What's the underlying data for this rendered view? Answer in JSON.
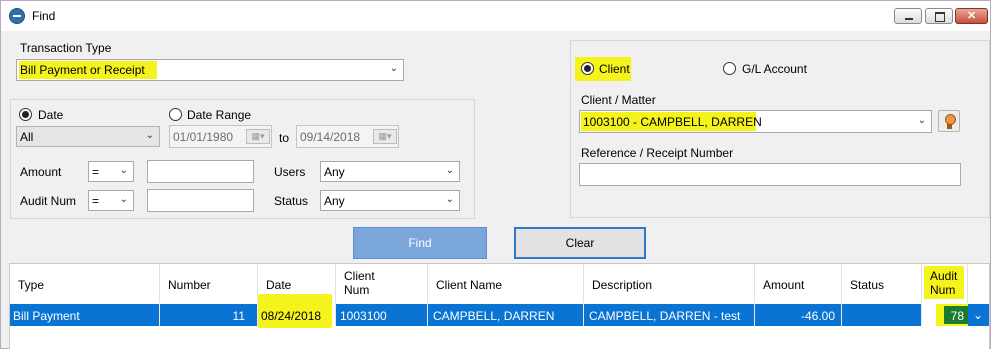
{
  "window": {
    "title": "Find"
  },
  "transaction_type": {
    "label": "Transaction Type",
    "value": "Bill Payment or Receipt"
  },
  "date_filter": {
    "date_label": "Date",
    "date_range_label": "Date Range",
    "period_value": "All",
    "from_date": "01/01/1980",
    "to_label": "to",
    "to_date": "09/14/2018"
  },
  "amount": {
    "label": "Amount",
    "operator": "=",
    "value": ""
  },
  "audit_num": {
    "label": "Audit Num",
    "operator": "=",
    "value": ""
  },
  "users": {
    "label": "Users",
    "value": "Any"
  },
  "status": {
    "label": "Status",
    "value": "Any"
  },
  "account_type": {
    "client_label": "Client",
    "gl_label": "G/L Account",
    "selected": "Client"
  },
  "client_matter": {
    "label": "Client / Matter",
    "value": "1003100 - CAMPBELL, DARREN"
  },
  "reference": {
    "label": "Reference / Receipt Number",
    "value": ""
  },
  "buttons": {
    "find": "Find",
    "clear": "Clear"
  },
  "results": {
    "columns": [
      {
        "label": "Type"
      },
      {
        "label": "Number"
      },
      {
        "label": "Date"
      },
      {
        "label": "Client\nNum"
      },
      {
        "label": "Client Name"
      },
      {
        "label": "Description"
      },
      {
        "label": "Amount"
      },
      {
        "label": "Status"
      },
      {
        "label": "Audit\nNum"
      }
    ],
    "rows": [
      {
        "type": "Bill Payment",
        "number": "11",
        "date": "08/24/2018",
        "client_num": "1003100",
        "client_name": "CAMPBELL, DARREN",
        "description": "CAMPBELL, DARREN - test",
        "amount": "-46.00",
        "status": "",
        "audit_num": "78"
      }
    ]
  },
  "colors": {
    "selection": "#0a74d4",
    "highlight": "#f5f31c",
    "find_button": "#7ba6dc"
  }
}
